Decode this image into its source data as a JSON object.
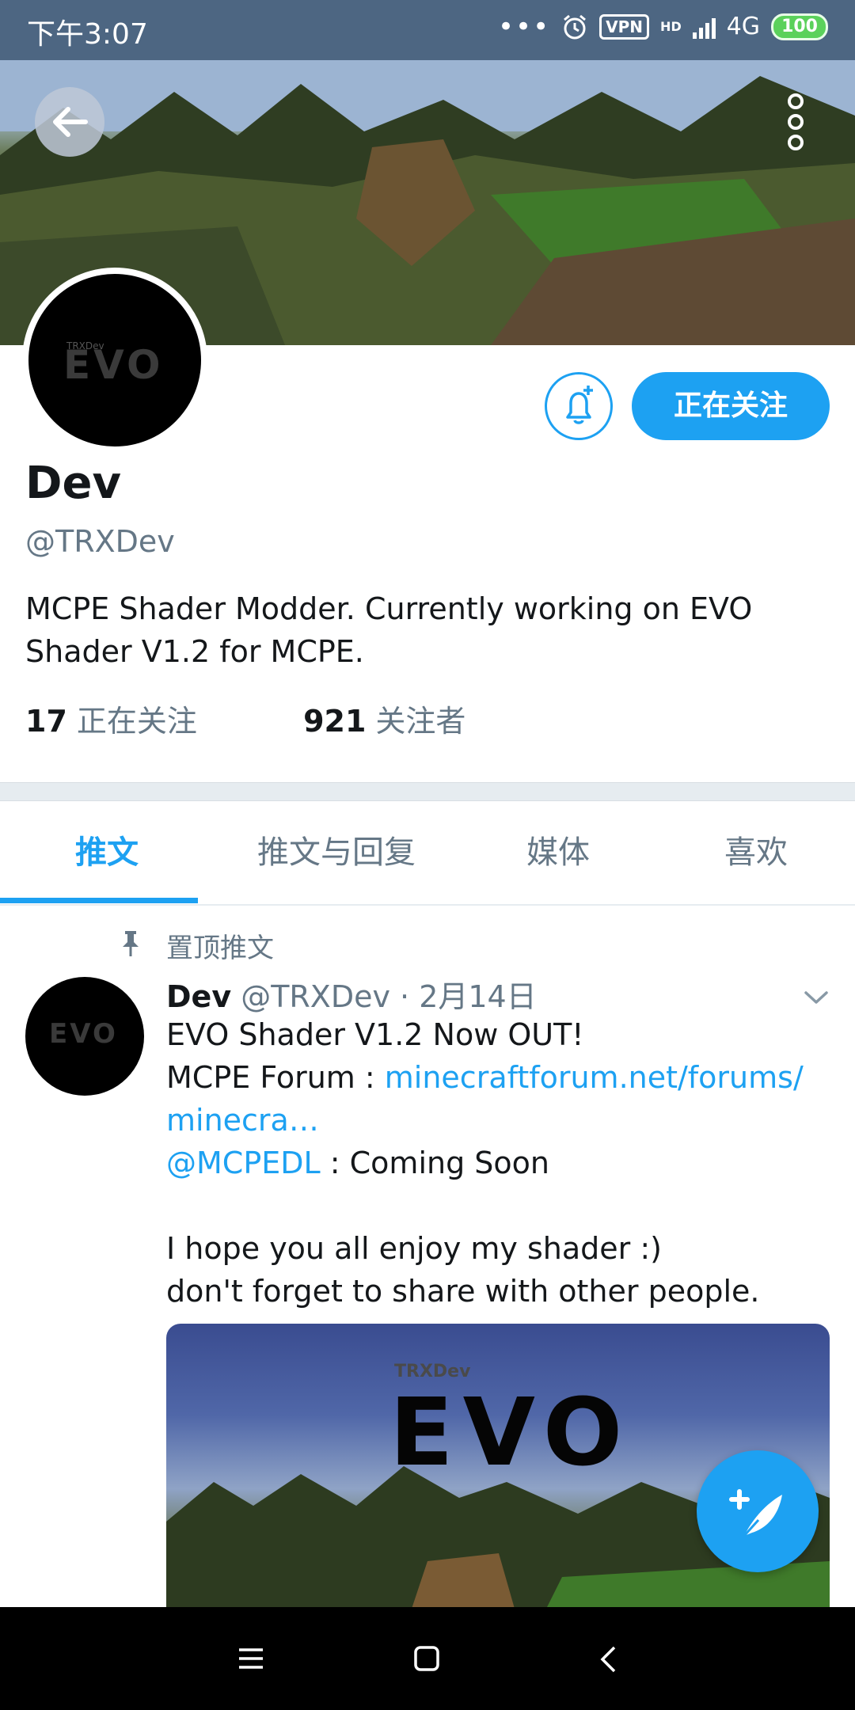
{
  "status_bar": {
    "time": "下午3:07",
    "dots": "•••",
    "vpn": "VPN",
    "network": "4G",
    "hd": "HD",
    "battery": "100"
  },
  "profile": {
    "name": "Dev",
    "handle": "@TRXDev",
    "bio_line1": "MCPE Shader Modder. Currently working on EVO",
    "bio_line2": "Shader V1.2 for MCPE.",
    "follow_button": "正在关注",
    "following_count": "17",
    "following_label": "正在关注",
    "followers_count": "921",
    "followers_label": "关注者",
    "avatar_logo": "EVO",
    "avatar_tag": "TRXDev"
  },
  "tabs": [
    {
      "label": "推文",
      "active": true
    },
    {
      "label": "推文与回复",
      "active": false
    },
    {
      "label": "媒体",
      "active": false
    },
    {
      "label": "喜欢",
      "active": false
    }
  ],
  "tweet": {
    "pinned_label": "置顶推文",
    "author_name": "Dev",
    "author_meta": "@TRXDev · 2月14日",
    "line1": "EVO Shader V1.2 Now OUT!",
    "line2_prefix": "MCPE Forum : ",
    "line2_link": "minecraftforum.net/forums/",
    "line3_link": "minecra…",
    "line4_mention": "@MCPEDL",
    "line4_suffix": " : Coming Soon",
    "line5": "I hope you all enjoy my shader :)",
    "line6": "don't forget to share with other people.",
    "media_tag": "TRXDev",
    "media_logo": "EVO"
  },
  "colors": {
    "accent": "#1da1f2",
    "status_bar": "#4d6682",
    "muted_text": "#657786"
  }
}
